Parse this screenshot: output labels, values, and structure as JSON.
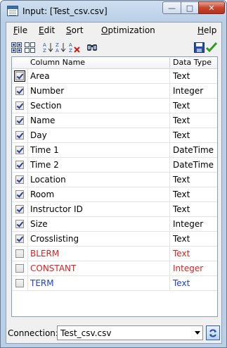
{
  "window": {
    "title": "Input: [Test_csv.csv]",
    "min_glyph": "—",
    "max_glyph": "□",
    "close_glyph": "✕"
  },
  "menu": [
    {
      "label": "File",
      "accel": "F",
      "rest": "ile"
    },
    {
      "label": "Edit",
      "accel": "E",
      "rest": "dit"
    },
    {
      "label": "Sort",
      "accel": "S",
      "rest": "ort"
    },
    {
      "label": "Optimization",
      "accel": "O",
      "rest": "ptimization"
    },
    {
      "label": "Help",
      "accel": "H",
      "rest": "elp"
    }
  ],
  "toolbar": {
    "icons": [
      "select-all-icon",
      "deselect-all-icon",
      "sort-ascending-icon",
      "sort-descending-icon",
      "clear-sort-icon",
      "find-icon",
      "save-icon",
      "ok-checkmark-icon"
    ]
  },
  "grid": {
    "headers": {
      "name": "Column Name",
      "type": "Data Type"
    },
    "rows": [
      {
        "name": "Area",
        "type": "Text",
        "checked": true,
        "color": "#000000"
      },
      {
        "name": "Number",
        "type": "Integer",
        "checked": true,
        "color": "#000000"
      },
      {
        "name": "Section",
        "type": "Text",
        "checked": true,
        "color": "#000000"
      },
      {
        "name": "Name",
        "type": "Text",
        "checked": true,
        "color": "#000000"
      },
      {
        "name": "Day",
        "type": "Text",
        "checked": true,
        "color": "#000000"
      },
      {
        "name": "Time 1",
        "type": "DateTime",
        "checked": true,
        "color": "#000000"
      },
      {
        "name": "Time 2",
        "type": "DateTime",
        "checked": true,
        "color": "#000000"
      },
      {
        "name": "Location",
        "type": "Text",
        "checked": true,
        "color": "#000000"
      },
      {
        "name": "Room",
        "type": "Text",
        "checked": true,
        "color": "#000000"
      },
      {
        "name": "Instructor ID",
        "type": "Text",
        "checked": true,
        "color": "#000000"
      },
      {
        "name": "Size",
        "type": "Integer",
        "checked": true,
        "color": "#000000"
      },
      {
        "name": "Crosslisting",
        "type": "Text",
        "checked": true,
        "color": "#000000"
      },
      {
        "name": "BLERM",
        "type": "Text",
        "checked": false,
        "color": "#e02020"
      },
      {
        "name": "CONSTANT",
        "type": "Integer",
        "checked": false,
        "color": "#e02020"
      },
      {
        "name": "TERM",
        "type": "Text",
        "checked": false,
        "color": "#1f3fcf"
      }
    ]
  },
  "connection": {
    "label": "Connection:",
    "value": "Test_csv.csv"
  }
}
